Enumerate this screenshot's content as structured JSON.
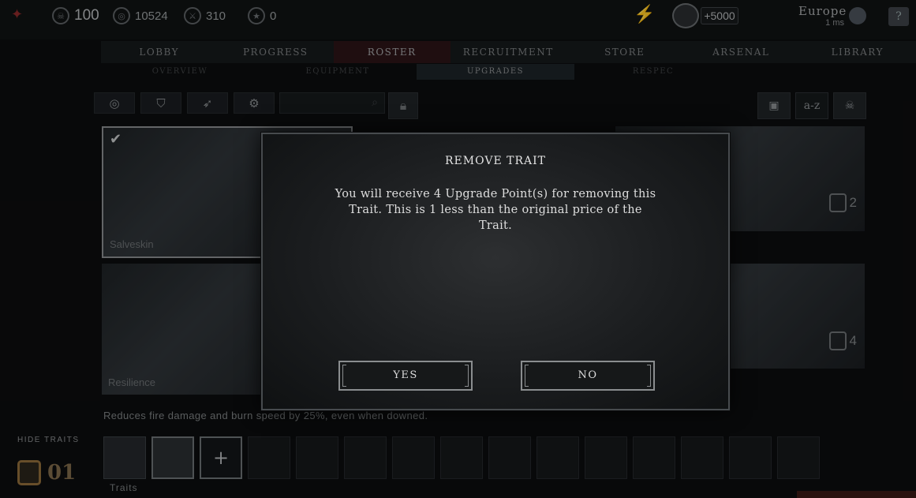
{
  "currencies": {
    "skulls": "100",
    "coins": "10524",
    "medals": "310",
    "stars": "0",
    "bonus": "+5000"
  },
  "region": {
    "name": "Europe",
    "ping": "1 ms"
  },
  "nav": {
    "tabs": [
      "LOBBY",
      "PROGRESS",
      "ROSTER",
      "RECRUITMENT",
      "STORE",
      "ARSENAL",
      "LIBRARY"
    ],
    "active": "ROSTER"
  },
  "subnav": {
    "tabs": [
      "OVERVIEW",
      "EQUIPMENT",
      "UPGRADES",
      "RESPEC"
    ],
    "active": "UPGRADES"
  },
  "sort": {
    "az_label": "a-z"
  },
  "cards": [
    {
      "label": "Salveskin",
      "selected": true
    },
    {
      "label": "Resilience"
    },
    {
      "cost": "2"
    },
    {
      "cost": "4"
    }
  ],
  "description": "Reduces fire damage and burn speed by 25%, even when downed.",
  "hide_traits_label": "HIDE TRAITS",
  "upgrade_points": "01",
  "traits_label": "Traits",
  "modal": {
    "title": "REMOVE TRAIT",
    "body": "You will receive 4 Upgrade Point(s) for removing this Trait. This is 1 less than the original price of the Trait.",
    "yes_label": "YES",
    "no_label": "NO"
  },
  "colors": {
    "accent": "#8f6d3b",
    "active_tab": "#2c1417"
  }
}
